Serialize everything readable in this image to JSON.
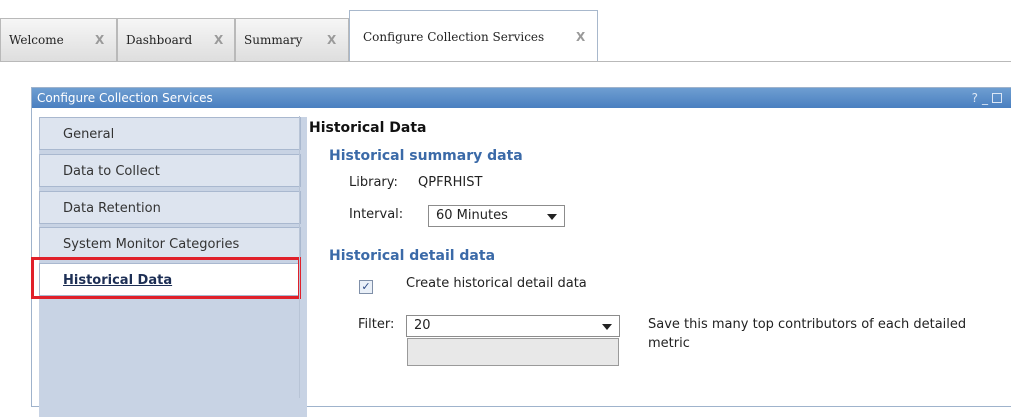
{
  "tabs": [
    {
      "label": "Welcome",
      "close": "X"
    },
    {
      "label": "Dashboard",
      "close": "X"
    },
    {
      "label": "Summary",
      "close": "X"
    },
    {
      "label": "Configure Collection Services",
      "close": "X",
      "active": true
    }
  ],
  "portlet": {
    "title": "Configure Collection Services",
    "controls": [
      "?",
      "_"
    ]
  },
  "nav": {
    "items": [
      {
        "label": "General"
      },
      {
        "label": "Data to Collect"
      },
      {
        "label": "Data Retention"
      },
      {
        "label": "System Monitor Categories"
      },
      {
        "label": "Historical Data",
        "selected": true
      }
    ]
  },
  "content": {
    "heading": "Historical Data",
    "summary": {
      "heading": "Historical summary data",
      "library_label": "Library:",
      "library_value": "QPFRHIST",
      "interval_label": "Interval:",
      "interval_value": "60 Minutes"
    },
    "detail": {
      "heading": "Historical detail data",
      "create_checked": true,
      "create_label": "Create historical detail data",
      "filter_label": "Filter:",
      "filter_value": "20",
      "filter_help": "Save this many top contributors of each detailed metric"
    }
  },
  "colors": {
    "title_bar": "#4a7fc0",
    "section_heading": "#3b6aa8",
    "highlight": "#e0202a"
  }
}
